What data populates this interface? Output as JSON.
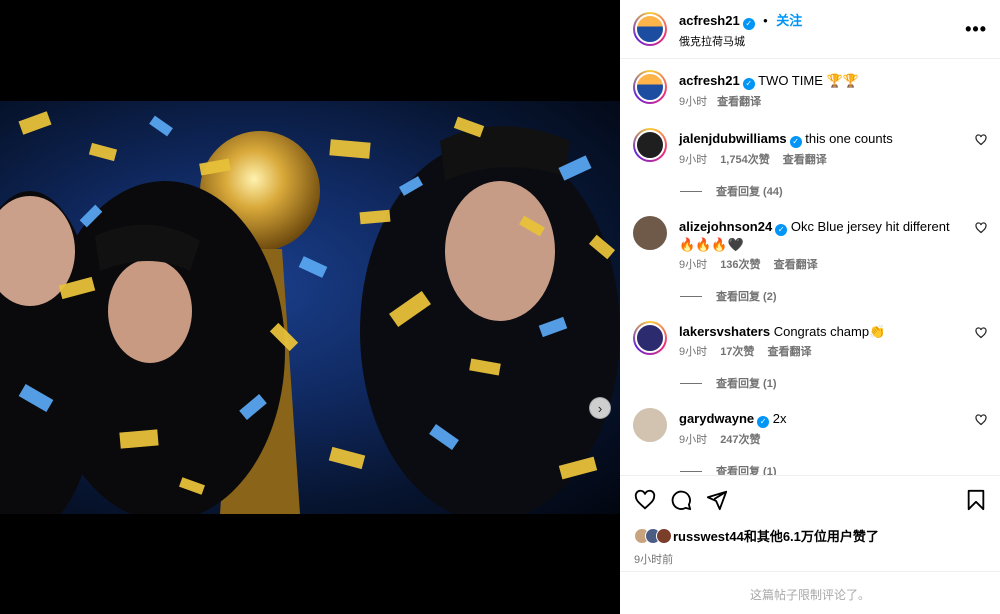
{
  "post": {
    "author": "acfresh21",
    "follow_label": "关注",
    "location": "俄克拉荷马城",
    "more_label": "•••"
  },
  "caption": {
    "user": "acfresh21",
    "text": "TWO TIME 🏆🏆",
    "time": "9小时",
    "translate": "查看翻译"
  },
  "comments": [
    {
      "user": "jalenjdubwilliams",
      "verified": true,
      "text": "this one counts",
      "time": "9小时",
      "likes": "1,754次赞",
      "translate": "查看翻译",
      "replies": "查看回复 (44)"
    },
    {
      "user": "alizejohnson24",
      "verified": true,
      "text": "Okc Blue jersey hit different 🔥🔥🔥🖤",
      "time": "9小时",
      "likes": "136次赞",
      "translate": "查看翻译",
      "replies": "查看回复 (2)"
    },
    {
      "user": "lakersvshaters",
      "verified": false,
      "text": "Congrats champ👏",
      "time": "9小时",
      "likes": "17次赞",
      "translate": "查看翻译",
      "replies": "查看回复 (1)"
    },
    {
      "user": "garydwayne",
      "verified": true,
      "text": "2x",
      "time": "9小时",
      "likes": "247次赞",
      "translate": "",
      "replies": "查看回复 (1)"
    }
  ],
  "likes_summary": "russwest44和其他6.1万位用户赞了",
  "posted_time": "9小时前",
  "restricted_notice": "这篇帖子限制评论了。",
  "icons": {
    "like": "heart-icon",
    "comment": "comment-icon",
    "share": "share-icon",
    "save": "bookmark-icon",
    "verified": "verified-badge-icon",
    "next": "chevron-right-icon"
  },
  "colors": {
    "accent": "#0095f6",
    "muted": "#737373"
  },
  "carousel": {
    "slides": 10,
    "active": 0
  }
}
